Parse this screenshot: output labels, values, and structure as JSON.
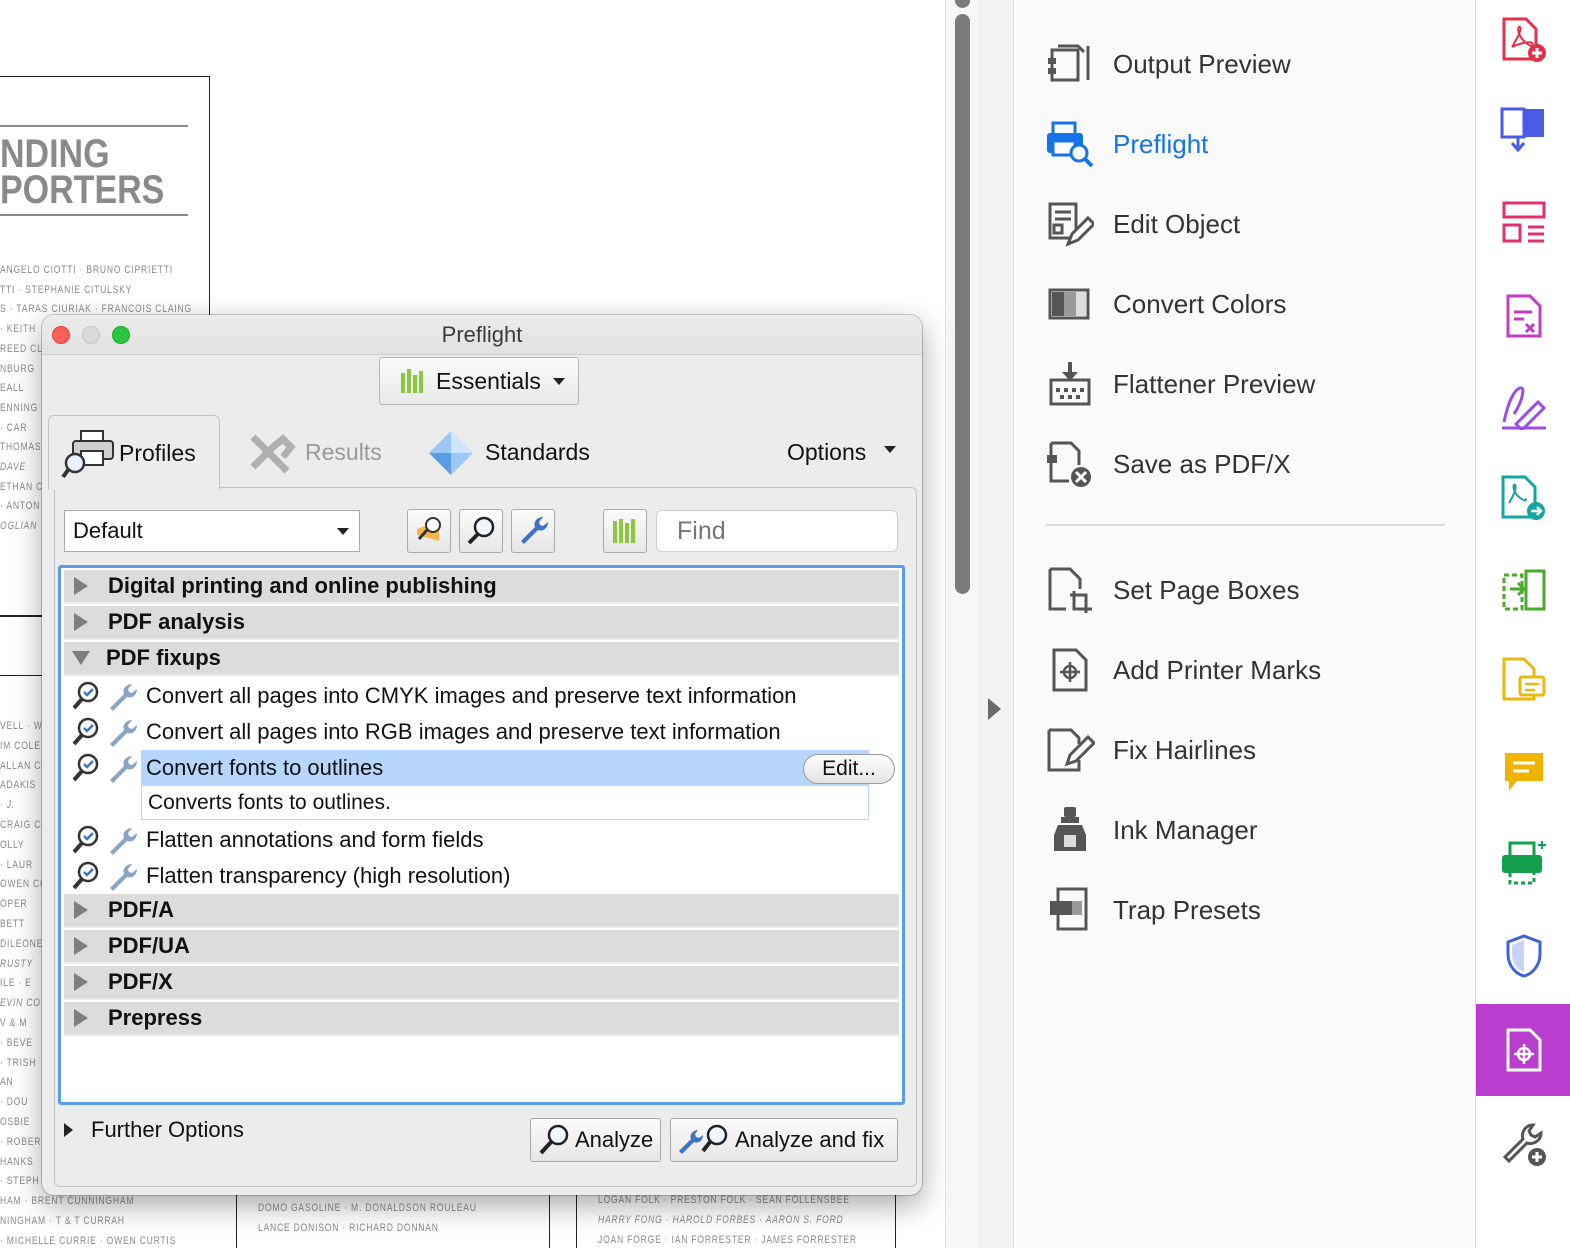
{
  "background_document": {
    "title_lines": [
      "NDING",
      "PORTERS"
    ],
    "name_lines": [
      "ANGELO CIOTTI  ·  BRUNO CIPRIETTI",
      "TTI  ·  STEPHANIE CITULSKY",
      "S · TARAS CIURIAK · FRANCOIS CLAING",
      "· KEITH",
      "REED CL",
      "NBURG",
      "EALL",
      "ENNING",
      "· CAR",
      "THOMAS",
      "DAVE",
      "ETHAN C",
      "· ANTON",
      "OGLIAN"
    ],
    "lower_names": [
      "VELL · W",
      "IM COLE",
      "ALLAN CO",
      "ADAKIS",
      "· J.",
      "CRAIG CO",
      "OLLY",
      "· LAUR",
      "OWEN CO",
      "OPER",
      "BETT",
      "DILEONE",
      "RUSTY",
      "ILE · E",
      "EVIN CO",
      "V & M",
      "· BEVE",
      "· TRISH",
      "AN",
      "· DOU",
      "OSBIE",
      "· ROBER",
      "HANKS",
      "· STEPH",
      "HAM  ·  BRENT CUNNINGHAM",
      "NINGHAM  ·  T & T CURRAH",
      "· MICHELLE CURRIE  ·  OWEN CURTIS"
    ],
    "bottom_col2": [
      "DOMO GASOLINE  ·  M. DONALDSON ROULEAU",
      "LANCE DONISON  ·  RICHARD DONNAN"
    ],
    "bottom_col3": [
      "LOGAN FOLK  ·  PRESTON FOLK  ·  SEAN FOLLENSBEE",
      "HARRY FONG  ·  HAROLD FORBES  ·  AARON S. FORD",
      "JOAN FORGE  ·  IAN FORRESTER  ·  JAMES FORRESTER"
    ]
  },
  "tools_panel": {
    "group1": [
      {
        "label": "Output Preview",
        "icon": "output-preview-icon"
      },
      {
        "label": "Preflight",
        "icon": "preflight-icon",
        "active": true
      },
      {
        "label": "Edit Object",
        "icon": "edit-object-icon"
      },
      {
        "label": "Convert Colors",
        "icon": "convert-colors-icon"
      },
      {
        "label": "Flattener Preview",
        "icon": "flattener-preview-icon"
      },
      {
        "label": "Save as PDF/X",
        "icon": "save-as-pdfx-icon"
      }
    ],
    "group2": [
      {
        "label": "Set Page Boxes",
        "icon": "set-page-boxes-icon"
      },
      {
        "label": "Add Printer Marks",
        "icon": "add-printer-marks-icon"
      },
      {
        "label": "Fix Hairlines",
        "icon": "fix-hairlines-icon"
      },
      {
        "label": "Ink Manager",
        "icon": "ink-manager-icon"
      },
      {
        "label": "Trap Presets",
        "icon": "trap-presets-icon"
      }
    ],
    "active_color": "#1473e6"
  },
  "right_rail": {
    "icons": [
      "create-pdf-icon",
      "combine-files-icon",
      "organize-pages-icon",
      "edit-pdf-icon",
      "fill-sign-icon",
      "export-pdf-icon",
      "compare-files-icon",
      "comment-icon",
      "sticky-note-icon",
      "print-production-icon",
      "protect-icon",
      "print-production-selected-icon",
      "more-tools-icon"
    ],
    "selected_color": "#b93ecf"
  },
  "dialog": {
    "title": "Preflight",
    "library_button": "Essentials",
    "tabs": {
      "profiles": "Profiles",
      "results": "Results",
      "standards": "Standards",
      "options": "Options"
    },
    "profile_select": "Default",
    "find_placeholder": "Find",
    "groups": {
      "g1": "Digital printing and online publishing",
      "g2": "PDF analysis",
      "g3": "PDF fixups",
      "g4": "PDF/A",
      "g5": "PDF/UA",
      "g6": "PDF/X",
      "g7": "Prepress"
    },
    "fixups": {
      "f1": "Convert all pages into CMYK images and preserve text information",
      "f2": "Convert all pages into RGB images and preserve text information",
      "f3": "Convert fonts to outlines",
      "f3_desc": "Converts fonts to outlines.",
      "f4": "Flatten annotations and form fields",
      "f5": "Flatten transparency (high resolution)"
    },
    "edit_button": "Edit...",
    "further_options": "Further Options",
    "analyze_button": "Analyze",
    "analyze_fix_button": "Analyze and fix",
    "selection_color": "#b6d6fb"
  }
}
